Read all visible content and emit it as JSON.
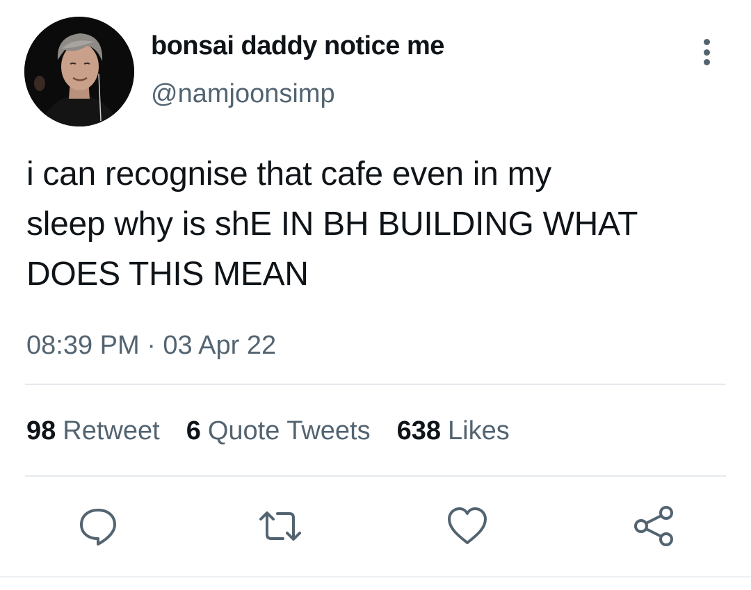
{
  "author": {
    "display_name": "bonsai daddy notice me",
    "handle": "@namjoonsimp"
  },
  "tweet": {
    "text": "i can recognise that cafe even in my\nsleep why is shE IN BH BUILDING WHAT\nDOES THIS MEAN",
    "timestamp": "08:39 PM · 03 Apr 22"
  },
  "stats": {
    "retweets_count": "98",
    "retweets_label": "Retweet",
    "quotes_count": "6",
    "quotes_label": "Quote Tweets",
    "likes_count": "638",
    "likes_label": "Likes"
  },
  "actions": {
    "reply_icon": "reply-icon",
    "retweet_icon": "retweet-icon",
    "like_icon": "heart-icon",
    "share_icon": "share-icon"
  },
  "colors": {
    "text_primary": "#0f1419",
    "text_secondary": "#536471",
    "divider": "#e6eaee"
  }
}
